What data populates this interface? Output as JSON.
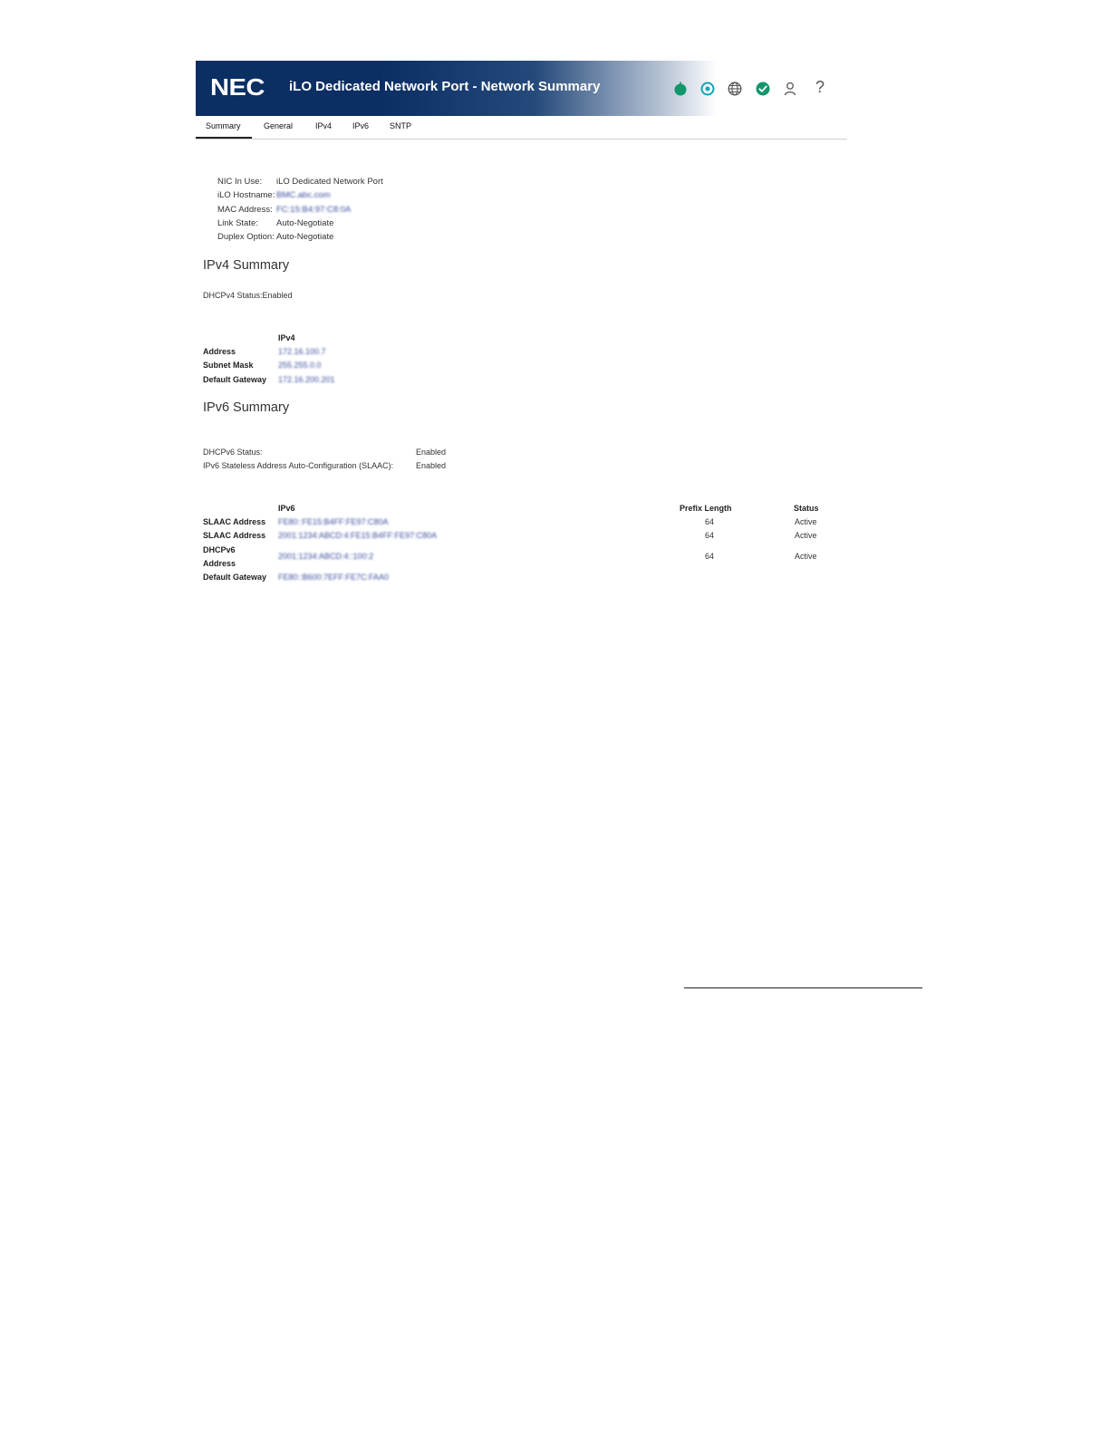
{
  "header": {
    "logo_text": "NEC",
    "title": "iLO Dedicated Network Port - Network Summary",
    "status_icons": [
      "health-icon",
      "target-icon",
      "globe-icon",
      "check-icon",
      "user-icon",
      "help-icon"
    ],
    "help_glyph": "?"
  },
  "tabs": [
    {
      "label": "Summary",
      "active": true
    },
    {
      "label": "General"
    },
    {
      "label": "IPv4"
    },
    {
      "label": "IPv6"
    },
    {
      "label": "SNTP"
    }
  ],
  "nic": {
    "rows": [
      {
        "label": "NIC In Use:",
        "value": "iLO Dedicated Network Port"
      },
      {
        "label": "iLO Hostname:",
        "value": "BMC.abc.com"
      },
      {
        "label": "MAC Address:",
        "value": "FC:15:B4:97:C8:0A"
      },
      {
        "label": "Link State:",
        "value": "Auto-Negotiate"
      },
      {
        "label": "Duplex Option:",
        "value": "Auto-Negotiate"
      }
    ]
  },
  "ipv4": {
    "title": "IPv4 Summary",
    "dhcp_label": "DHCPv4 Status:",
    "dhcp_value": "Enabled",
    "column_header": "IPv4",
    "rows": [
      {
        "label": "Address",
        "value": "172.16.100.7"
      },
      {
        "label": "Subnet Mask",
        "value": "255.255.0.0"
      },
      {
        "label": "Default Gateway",
        "value": "172.16.200.201"
      }
    ]
  },
  "ipv6": {
    "title": "IPv6 Summary",
    "dhcp_label": "DHCPv6 Status:",
    "dhcp_value": "Enabled",
    "slaac_label": "IPv6 Stateless Address Auto-Configuration (SLAAC):",
    "slaac_value": "Enabled",
    "columns": {
      "addr": "IPv6",
      "prefix": "Prefix Length",
      "status": "Status"
    },
    "rows": [
      {
        "label": "SLAAC Address",
        "value": "FE80::FE15:B4FF:FE97:C80A",
        "prefix": "64",
        "status": "Active"
      },
      {
        "label": "SLAAC Address",
        "value": "2001:1234:ABCD:4:FE15:B4FF:FE97:C80A",
        "prefix": "64",
        "status": "Active"
      },
      {
        "label_line1": "DHCPv6",
        "label_line2": "Address",
        "value": "2001:1234:ABCD:4::100:2",
        "prefix": "64",
        "status": "Active"
      },
      {
        "label": "Default Gateway",
        "value": "FE80::B600:7EFF:FE7C:FAA0"
      }
    ]
  }
}
